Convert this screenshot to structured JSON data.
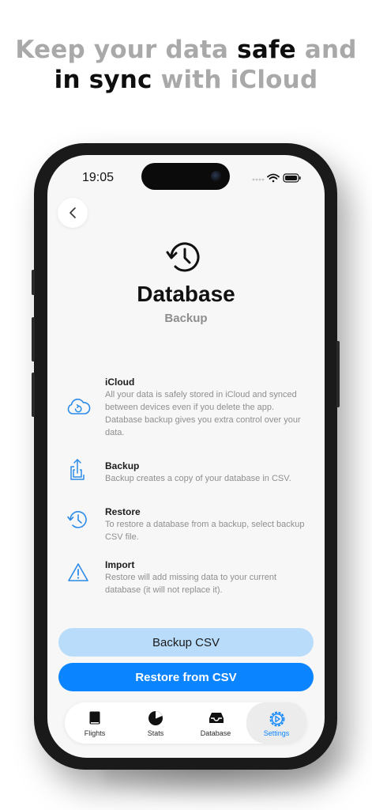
{
  "headline": {
    "line1_grey": "Keep your data ",
    "line1_bold": "safe",
    "line1_end": " and",
    "line2_bold": "in sync",
    "line2_grey": " with iCloud"
  },
  "status_bar": {
    "time": "19:05"
  },
  "page": {
    "title": "Database",
    "subtitle": "Backup",
    "hero_icon": "history-clock-icon"
  },
  "features": [
    {
      "icon": "icloud-sync-icon",
      "title": "iCloud",
      "description": "All your data is safely stored in iCloud and synced between devices even if you delete the app. Database backup gives you extra control over your data."
    },
    {
      "icon": "share-export-icon",
      "title": "Backup",
      "description": "Backup creates a copy of your database in CSV."
    },
    {
      "icon": "restore-clock-icon",
      "title": "Restore",
      "description": "To restore a database from a backup, select backup CSV file."
    },
    {
      "icon": "warning-triangle-icon",
      "title": "Import",
      "description": "Restore will add missing data to your current database (it will not replace it)."
    }
  ],
  "buttons": {
    "backup_label": "Backup CSV",
    "restore_label": "Restore from CSV"
  },
  "tabs": [
    {
      "label": "Flights",
      "icon": "book-icon",
      "active": false
    },
    {
      "label": "Stats",
      "icon": "pie-chart-icon",
      "active": false
    },
    {
      "label": "Database",
      "icon": "tray-icon",
      "active": false
    },
    {
      "label": "Settings",
      "icon": "gear-icon",
      "active": true
    }
  ],
  "colors": {
    "accent": "#0a84ff",
    "backup_button_bg": "#b9dcfb",
    "headline_grey": "#a9a9a9"
  }
}
